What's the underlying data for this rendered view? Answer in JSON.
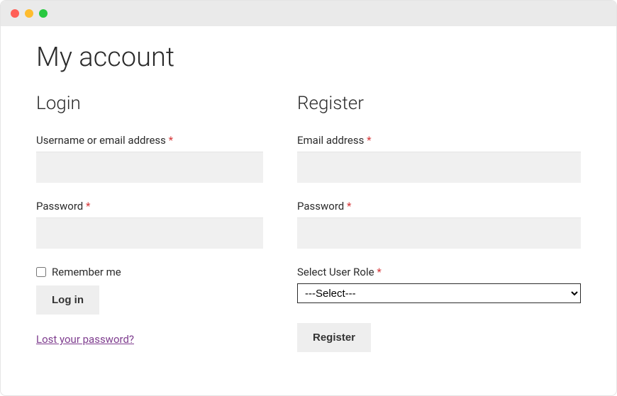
{
  "page": {
    "title": "My account"
  },
  "login": {
    "heading": "Login",
    "username_label": "Username or email address",
    "password_label": "Password",
    "remember_label": "Remember me",
    "submit_label": "Log in",
    "lost_password_label": "Lost your password?",
    "required_mark": "*"
  },
  "register": {
    "heading": "Register",
    "email_label": "Email address",
    "password_label": "Password",
    "role_label": "Select User Role",
    "role_placeholder": "---Select---",
    "submit_label": "Register",
    "required_mark": "*"
  }
}
